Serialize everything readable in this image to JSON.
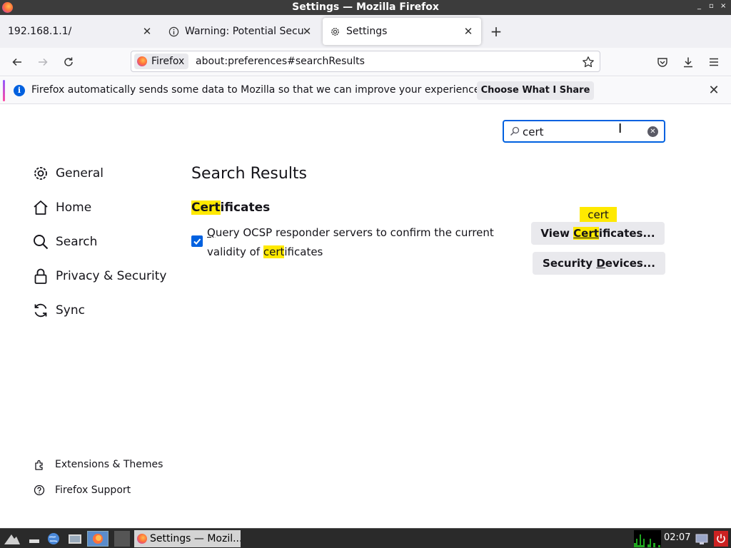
{
  "window": {
    "title": "Settings — Mozilla Firefox"
  },
  "tabs": [
    {
      "label": "192.168.1.1/"
    },
    {
      "label": "Warning: Potential Securi"
    },
    {
      "label": "Settings"
    }
  ],
  "urlbar": {
    "identity_label": "Firefox",
    "url": "about:preferences#searchResults"
  },
  "notification": {
    "text": "Firefox automatically sends some data to Mozilla so that we can improve your experience.",
    "button_label": "Choose What I Share"
  },
  "search": {
    "value": "cert"
  },
  "sidebar": {
    "items": [
      {
        "label": "General",
        "icon": "gear-icon"
      },
      {
        "label": "Home",
        "icon": "home-icon"
      },
      {
        "label": "Search",
        "icon": "search-icon"
      },
      {
        "label": "Privacy & Security",
        "icon": "lock-icon"
      },
      {
        "label": "Sync",
        "icon": "sync-icon"
      }
    ],
    "footer": [
      {
        "label": "Extensions & Themes",
        "icon": "puzzle-icon"
      },
      {
        "label": "Firefox Support",
        "icon": "help-icon"
      }
    ]
  },
  "results": {
    "title": "Search Results",
    "section_heading_highlight": "Cert",
    "section_heading_rest": "ificates",
    "ocsp_checked": true,
    "ocsp_label_line1_first": "Q",
    "ocsp_label_line1_rest": "uery OCSP responder servers to confirm the current",
    "ocsp_label_line2_pre": "validity of ",
    "ocsp_label_line2_highlight": "cert",
    "ocsp_label_line2_post": "ificates",
    "view_certs_pre": "View ",
    "view_certs_highlight": "Cert",
    "view_certs_post": "ificates...",
    "sec_devices_pre": "Security ",
    "sec_devices_accesskey": "D",
    "sec_devices_post": "evices...",
    "tooltip": "cert"
  },
  "taskbar": {
    "task_label": "Settings — Mozil...",
    "clock": "02:07"
  },
  "colors": {
    "accent": "#0061e0",
    "highlight": "#ffe900"
  }
}
